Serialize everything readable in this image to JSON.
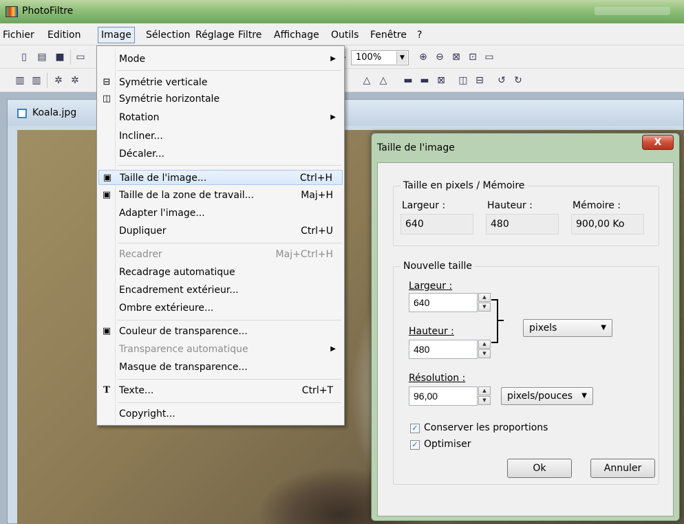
{
  "app": {
    "title": "PhotoFiltre"
  },
  "menubar": {
    "items": [
      "Fichier",
      "Edition",
      "Image",
      "Sélection",
      "Réglage",
      "Filtre",
      "Affichage",
      "Outils",
      "Fenêtre",
      "?"
    ]
  },
  "toolbar": {
    "zoom": "100%"
  },
  "document": {
    "name": "Koala.jpg"
  },
  "image_menu": {
    "items": [
      {
        "label": "Mode",
        "submenu": true
      },
      {
        "label": "Symétrie verticale",
        "icon": "flip-vertical-icon"
      },
      {
        "label": "Symétrie horizontale",
        "icon": "flip-horizontal-icon"
      },
      {
        "label": "Rotation",
        "submenu": true
      },
      {
        "label": "Incliner..."
      },
      {
        "label": "Décaler..."
      },
      {
        "label": "Taille de l'image...",
        "shortcut": "Ctrl+H",
        "icon": "image-size-icon",
        "highlighted": true
      },
      {
        "label": "Taille de la zone de travail...",
        "shortcut": "Maj+H",
        "icon": "canvas-size-icon"
      },
      {
        "label": "Adapter l'image..."
      },
      {
        "label": "Dupliquer",
        "shortcut": "Ctrl+U"
      },
      {
        "label": "Recadrer",
        "shortcut": "Maj+Ctrl+H",
        "disabled": true
      },
      {
        "label": "Recadrage automatique"
      },
      {
        "label": "Encadrement extérieur..."
      },
      {
        "label": "Ombre extérieure..."
      },
      {
        "label": "Couleur de transparence...",
        "icon": "transparency-color-icon"
      },
      {
        "label": "Transparence automatique",
        "submenu": true,
        "disabled": true
      },
      {
        "label": "Masque de transparence..."
      },
      {
        "label": "Texte...",
        "shortcut": "Ctrl+T",
        "icon": "text-icon"
      },
      {
        "label": "Copyright..."
      }
    ]
  },
  "dialog": {
    "title": "Taille de l'image",
    "close": "X",
    "pixels_group": {
      "title": "Taille en pixels / Mémoire",
      "width_label": "Largeur :",
      "width_value": "640",
      "height_label": "Hauteur :",
      "height_value": "480",
      "memory_label": "Mémoire :",
      "memory_value": "900,00 Ko"
    },
    "new_size_group": {
      "title": "Nouvelle taille",
      "width_label": "Largeur :",
      "width_value": "640",
      "height_label": "Hauteur :",
      "height_value": "480",
      "unit": "pixels",
      "resolution_label": "Résolution :",
      "resolution_value": "96,00",
      "resolution_unit": "pixels/pouces",
      "keep_proportions": "Conserver les proportions",
      "keep_proportions_checked": true,
      "optimize": "Optimiser",
      "optimize_checked": true
    },
    "ok": "Ok",
    "cancel": "Annuler"
  }
}
